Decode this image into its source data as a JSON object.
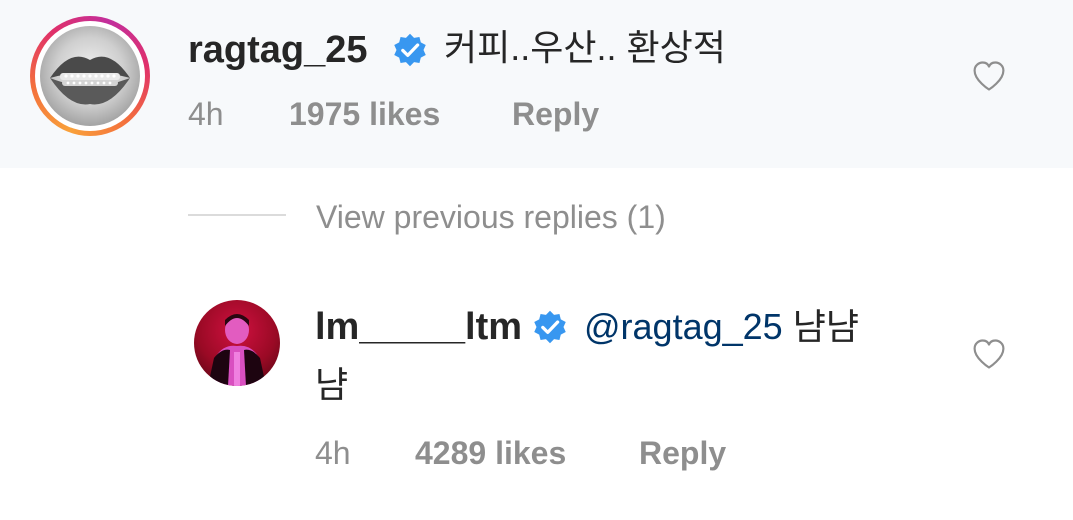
{
  "comments": [
    {
      "username": "ragtag_25",
      "verified": true,
      "text": "커피..우산.. 환상적",
      "time": "4h",
      "likes": "1975 likes",
      "reply_label": "Reply",
      "avatar_icon": "lips-grillz-avatar"
    }
  ],
  "thread": {
    "view_previous_label": "View previous replies (1)"
  },
  "replies": [
    {
      "username": "lm_____ltm",
      "verified": true,
      "mention": "@ragtag_25",
      "text_line1": "냠냠",
      "text_line2": "냠",
      "time": "4h",
      "likes": "4289 likes",
      "reply_label": "Reply",
      "avatar_icon": "person-red-avatar"
    }
  ],
  "colors": {
    "verified_badge": "#3897f0",
    "mention": "#003569",
    "meta_text": "#8e8e8e",
    "primary_text": "#262626",
    "highlight_background": "#f7f9fb"
  }
}
